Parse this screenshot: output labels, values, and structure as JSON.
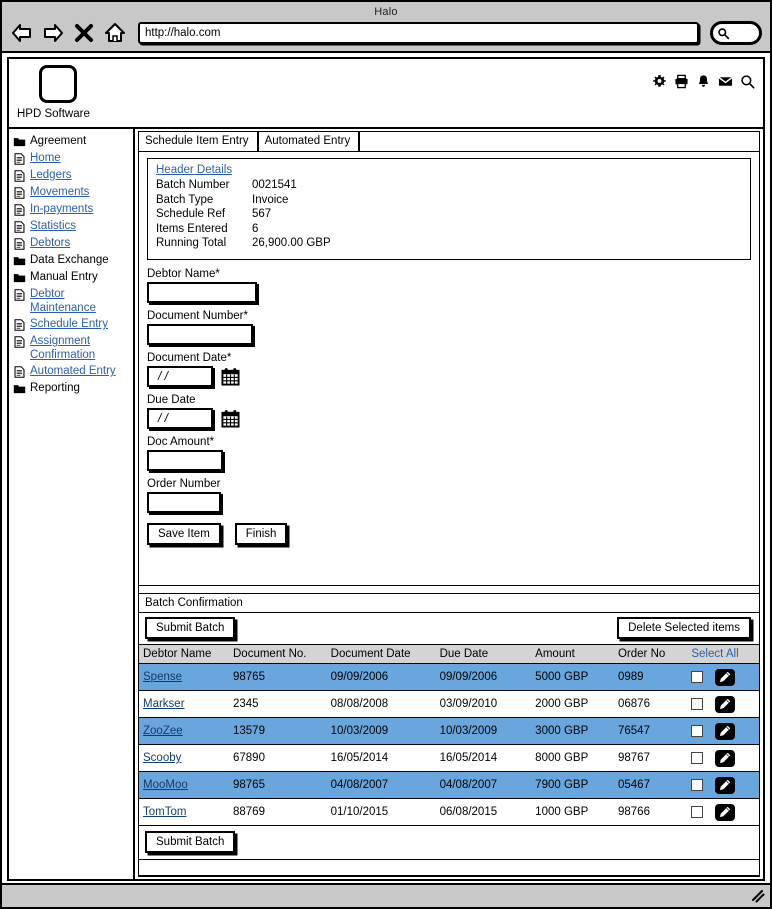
{
  "browser": {
    "title": "Halo",
    "url": "http://halo.com",
    "nav": {
      "back": "back-arrow",
      "forward": "forward-arrow",
      "stop": "close-x",
      "home": "home"
    },
    "search_icon": "search-icon"
  },
  "app_header": {
    "logo_text": "HPD Software",
    "icons": [
      "gear-icon",
      "printer-icon",
      "bell-icon",
      "envelope-icon",
      "search-icon"
    ]
  },
  "sidebar": {
    "items": [
      {
        "label": "Agreement",
        "icon": "folder-icon",
        "link": false
      },
      {
        "label": "Home",
        "icon": "document-icon",
        "link": true
      },
      {
        "label": "Ledgers",
        "icon": "document-icon",
        "link": true
      },
      {
        "label": "Movements",
        "icon": "document-icon",
        "link": true
      },
      {
        "label": "In-payments",
        "icon": "document-icon",
        "link": true
      },
      {
        "label": "Statistics",
        "icon": "document-icon",
        "link": true
      },
      {
        "label": "Debtors",
        "icon": "document-icon",
        "link": true
      },
      {
        "label": "Data Exchange",
        "icon": "folder-icon",
        "link": false
      },
      {
        "label": "Manual Entry",
        "icon": "folder-icon",
        "link": false
      },
      {
        "label": "Debtor Maintenance",
        "icon": "document-icon",
        "link": true
      },
      {
        "label": "Schedule Entry",
        "icon": "document-icon",
        "link": true
      },
      {
        "label": "Assignment Confirmation",
        "icon": "document-icon",
        "link": true
      },
      {
        "label": "Automated Entry",
        "icon": "document-icon",
        "link": true
      },
      {
        "label": "Reporting",
        "icon": "folder-icon",
        "link": false
      }
    ]
  },
  "tabs": [
    {
      "label": "Schedule Item Entry",
      "active": true
    },
    {
      "label": "Automated Entry",
      "active": false
    }
  ],
  "header_details": {
    "title": "Header Details",
    "rows": [
      {
        "key": "Batch Number",
        "value": "0021541"
      },
      {
        "key": "Batch Type",
        "value": "Invoice"
      },
      {
        "key": "Schedule Ref",
        "value": "567"
      },
      {
        "key": "Items Entered",
        "value": "6"
      },
      {
        "key": "Running Total",
        "value": "26,900.00 GBP"
      }
    ]
  },
  "form": {
    "fields": [
      {
        "label": "Debtor Name*",
        "value": "",
        "type": "text"
      },
      {
        "label": "Document Number*",
        "value": "",
        "type": "text"
      },
      {
        "label": "Document Date*",
        "value": "/ /",
        "type": "date"
      },
      {
        "label": "Due Date",
        "value": "/ /",
        "type": "date"
      },
      {
        "label": "Doc Amount*",
        "value": "",
        "type": "text"
      },
      {
        "label": "Order Number",
        "value": "",
        "type": "text"
      }
    ],
    "save_label": "Save Item",
    "finish_label": "Finish"
  },
  "batch": {
    "title": "Batch Confirmation",
    "submit_top_label": "Submit Batch",
    "delete_label": "Delete Selected items",
    "submit_bottom_label": "Submit Batch",
    "columns": [
      "Debtor Name",
      "Document No.",
      "Document Date",
      "Due Date",
      "Amount",
      "Order No",
      "Select All"
    ],
    "rows": [
      {
        "debtor": "Spense",
        "document_no": "98765",
        "document_date": "09/09/2006",
        "due_date": "09/09/2006",
        "amount": "5000 GBP",
        "order_no": "0989",
        "checked": false
      },
      {
        "debtor": "Markser",
        "document_no": "2345",
        "document_date": "08/08/2008",
        "due_date": "03/09/2010",
        "amount": "2000 GBP",
        "order_no": "06876",
        "checked": false
      },
      {
        "debtor": "ZooZee",
        "document_no": "13579",
        "document_date": "10/03/2009",
        "due_date": "10/03/2009",
        "amount": "3000 GBP",
        "order_no": "76547",
        "checked": false
      },
      {
        "debtor": "Scooby",
        "document_no": "67890",
        "document_date": "16/05/2014",
        "due_date": "16/05/2014",
        "amount": "8000 GBP",
        "order_no": "98767",
        "checked": false
      },
      {
        "debtor": "MooMoo",
        "document_no": "98765",
        "document_date": "04/08/2007",
        "due_date": "04/08/2007",
        "amount": "7900 GBP",
        "order_no": "05467",
        "checked": false
      },
      {
        "debtor": "TomTom",
        "document_no": "88769",
        "document_date": "01/10/2015",
        "due_date": "06/08/2015",
        "amount": "1000 GBP",
        "order_no": "98766",
        "checked": false
      }
    ]
  },
  "colors": {
    "row_highlight": "#6aa6de",
    "link": "#2c5fa8",
    "chrome": "#c8c8c8",
    "header_row": "#d4d4d4"
  }
}
